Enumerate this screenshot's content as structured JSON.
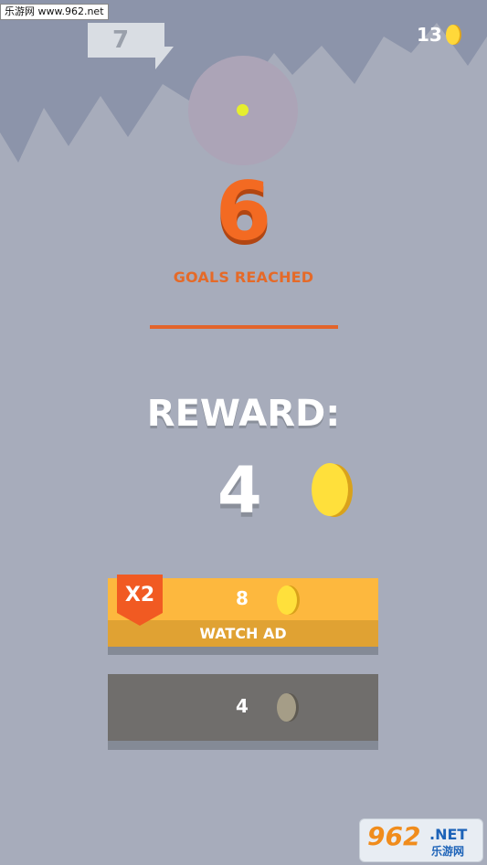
{
  "watermark": {
    "text": "乐游网 www.962.net"
  },
  "hud": {
    "score": "7",
    "coins": "13"
  },
  "goals": {
    "count": "6",
    "label": "GOALS REACHED"
  },
  "reward": {
    "label": "REWARD:",
    "amount": "4"
  },
  "watch_ad_button": {
    "badge": "X2",
    "amount": "8",
    "label": "WATCH AD"
  },
  "collect_button": {
    "amount": "4"
  },
  "logo": {
    "big": "962",
    "net": ".NET",
    "cn": "乐游网"
  },
  "colors": {
    "background": "#a7acbb",
    "accent_orange": "#f36a22",
    "coin_yellow": "#ffe03b",
    "watch_ad_yellow": "#fdb83e",
    "collect_gray": "#706e6c"
  },
  "icons": [
    "coin-icon",
    "target-ball-icon"
  ]
}
